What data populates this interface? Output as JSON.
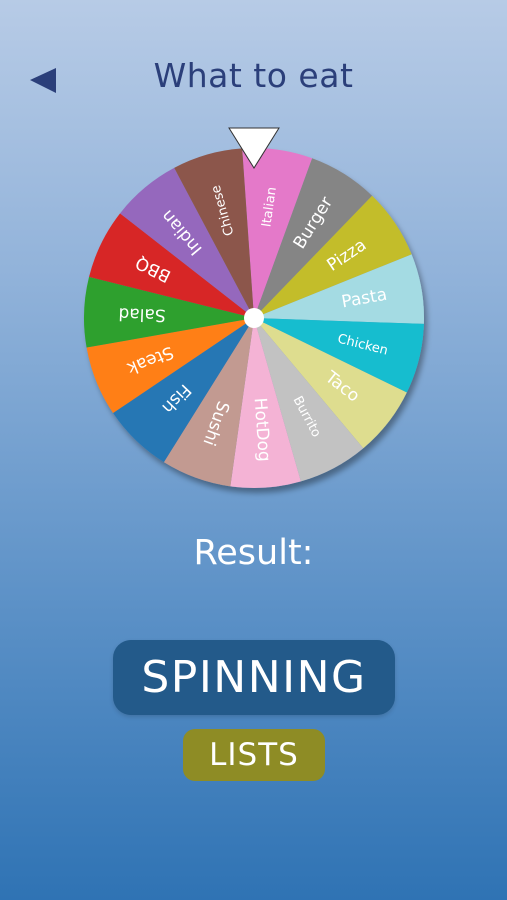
{
  "header": {
    "title": "What to eat",
    "back_icon": "back-arrow-icon"
  },
  "wheel": {
    "segments": [
      {
        "label": "Italian",
        "color": "#e479c9"
      },
      {
        "label": "Burger",
        "color": "#858585"
      },
      {
        "label": "Pizza",
        "color": "#c3bd2a"
      },
      {
        "label": "Pasta",
        "color": "#a4dbe3"
      },
      {
        "label": "Chicken",
        "color": "#19bdcf"
      },
      {
        "label": "Taco",
        "color": "#dedd8f"
      },
      {
        "label": "Burrito",
        "color": "#c2c2c2"
      },
      {
        "label": "HotDog",
        "color": "#f4b3d5"
      },
      {
        "label": "Sushi",
        "color": "#c29a91"
      },
      {
        "label": "Fish",
        "color": "#2877b4"
      },
      {
        "label": "Steak",
        "color": "#ff7f16"
      },
      {
        "label": "Salad",
        "color": "#2ea02d"
      },
      {
        "label": "BBQ",
        "color": "#d72828"
      },
      {
        "label": "Indian",
        "color": "#9568bd"
      },
      {
        "label": "Chinese",
        "color": "#8c574c"
      }
    ],
    "pointer_icon": "pointer-triangle-icon"
  },
  "result": {
    "label": "Result:",
    "value": ""
  },
  "buttons": {
    "spin_label": "SPINNING",
    "lists_label": "LISTS"
  },
  "colors": {
    "title": "#2b3f7a",
    "spin_button": "#235a8a",
    "lists_button": "#8e8c25"
  }
}
